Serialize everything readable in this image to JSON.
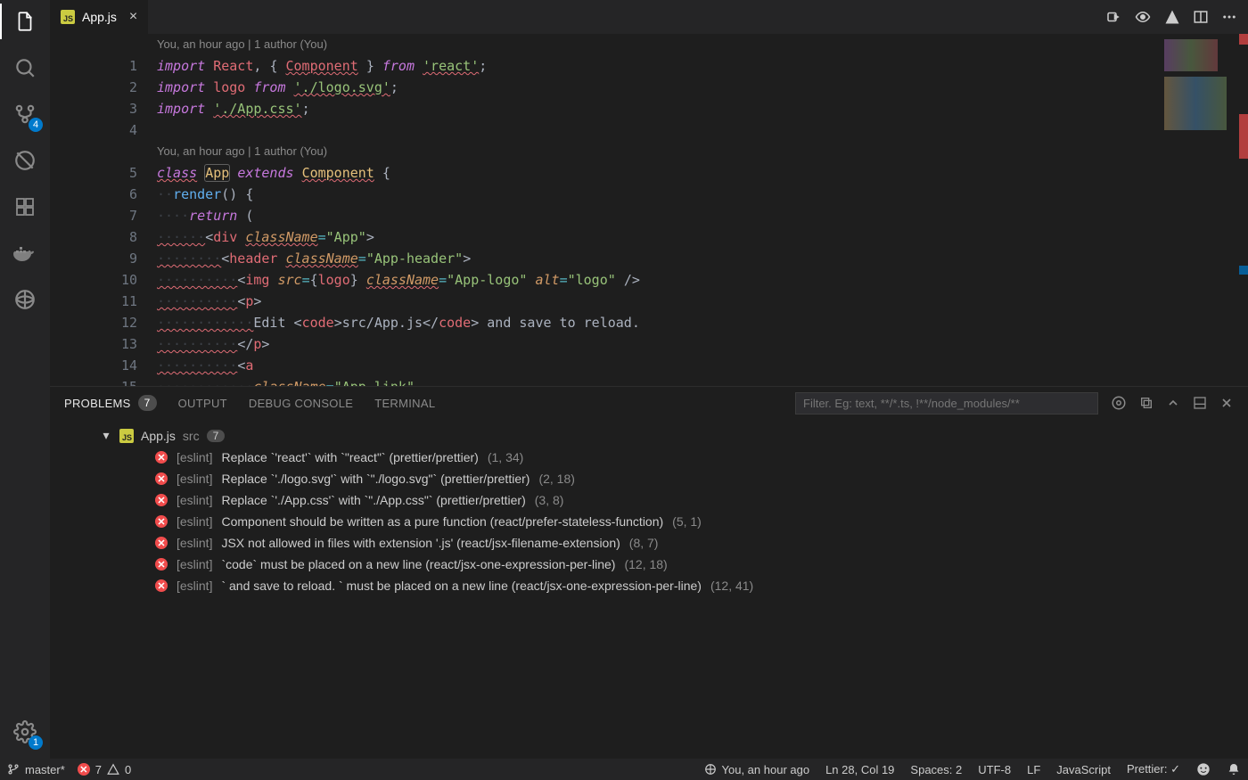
{
  "tab": {
    "filename": "App.js",
    "icon_text": "JS"
  },
  "title_actions": [
    "nav-back-icon",
    "preview-icon",
    "diff-icon",
    "split-editor-icon",
    "more-icon"
  ],
  "activity": {
    "items": [
      {
        "name": "explorer-icon",
        "active": true
      },
      {
        "name": "search-icon",
        "active": false
      },
      {
        "name": "source-control-icon",
        "active": false,
        "badge": "4"
      },
      {
        "name": "debug-icon",
        "active": false
      },
      {
        "name": "extensions-icon",
        "active": false
      },
      {
        "name": "docker-icon",
        "active": false
      },
      {
        "name": "live-share-icon",
        "active": false
      }
    ],
    "bottom_badge": "1"
  },
  "codelens1": "You, an hour ago | 1 author (You)",
  "codelens2": "You, an hour ago | 1 author (You)",
  "code_lines": {
    "1": "import React, { Component } from 'react';",
    "2": "import logo from './logo.svg';",
    "3": "import './App.css';",
    "4": "",
    "5": "class App extends Component {",
    "6": "  render() {",
    "7": "    return (",
    "8": "      <div className=\"App\">",
    "9": "        <header className=\"App-header\">",
    "10": "          <img src={logo} className=\"App-logo\" alt=\"logo\" />",
    "11": "          <p>",
    "12": "            Edit <code>src/App.js</code> and save to reload.",
    "13": "          </p>",
    "14": "          <a",
    "15": "            className=\"App-link\""
  },
  "panel": {
    "tabs": {
      "problems": "Problems",
      "problems_count": "7",
      "output": "Output",
      "debug_console": "Debug Console",
      "terminal": "Terminal"
    },
    "filter_placeholder": "Filter. Eg: text, **/*.ts, !**/node_modules/**",
    "file": {
      "name": "App.js",
      "dir": "src",
      "count": "7"
    },
    "items": [
      {
        "src": "[eslint]",
        "msg": "Replace `'react'` with `\"react\"` (prettier/prettier)",
        "loc": "(1, 34)"
      },
      {
        "src": "[eslint]",
        "msg": "Replace `'./logo.svg'` with `\"./logo.svg\"` (prettier/prettier)",
        "loc": "(2, 18)"
      },
      {
        "src": "[eslint]",
        "msg": "Replace `'./App.css'` with `\"./App.css\"` (prettier/prettier)",
        "loc": "(3, 8)"
      },
      {
        "src": "[eslint]",
        "msg": "Component should be written as a pure function (react/prefer-stateless-function)",
        "loc": "(5, 1)"
      },
      {
        "src": "[eslint]",
        "msg": "JSX not allowed in files with extension '.js' (react/jsx-filename-extension)",
        "loc": "(8, 7)"
      },
      {
        "src": "[eslint]",
        "msg": "`code` must be placed on a new line (react/jsx-one-expression-per-line)",
        "loc": "(12, 18)"
      },
      {
        "src": "[eslint]",
        "msg": "` and save to reload. ` must be placed on a new line (react/jsx-one-expression-per-line)",
        "loc": "(12, 41)"
      }
    ]
  },
  "status": {
    "branch": "master*",
    "errors": "7",
    "warnings": "0",
    "blame": "You, an hour ago",
    "cursor": "Ln 28, Col 19",
    "spaces": "Spaces: 2",
    "encoding": "UTF-8",
    "eol": "LF",
    "language": "JavaScript",
    "prettier": "Prettier: ✓"
  }
}
